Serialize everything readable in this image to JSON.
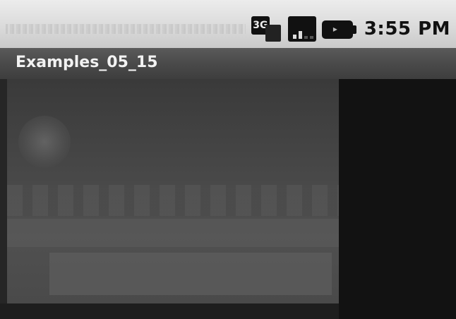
{
  "status_bar": {
    "network_label": "3G",
    "time": "3:55 PM",
    "icons": [
      "network-3g-icon",
      "signal-strength-icon",
      "battery-icon"
    ]
  },
  "title_bar": {
    "title": "Examples_05_15"
  },
  "content": {
    "image_view": "image-view"
  },
  "colors": {
    "status_bar_bg": "#d9d9d9",
    "title_bar_bg": "#4a4a4a",
    "content_bg": "#262626",
    "title_text": "#f2f2f2"
  }
}
